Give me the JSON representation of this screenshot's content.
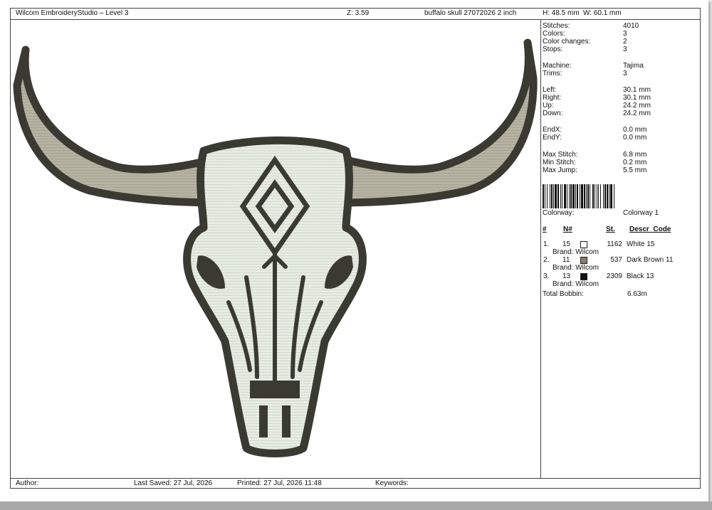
{
  "header": {
    "app_title": "Wilcom EmbroideryStudio – Level 3",
    "zoom": "Z: 3.59",
    "design_name": "buffalo skull 27072026 2 inch",
    "height": "H: 48.5 mm",
    "width": "W: 60.1 mm"
  },
  "stats": [
    {
      "label": "Stitches:",
      "value": "4010"
    },
    {
      "label": "Colors:",
      "value": "3"
    },
    {
      "label": "Color changes:",
      "value": "2"
    },
    {
      "label": "Stops:",
      "value": "3"
    },
    {
      "label": "Machine:",
      "value": "Tajima"
    },
    {
      "label": "Trims:",
      "value": "3"
    },
    {
      "label": "Left:",
      "value": "30.1 mm"
    },
    {
      "label": "Right:",
      "value": "30.1 mm"
    },
    {
      "label": "Up:",
      "value": "24.2 mm"
    },
    {
      "label": "Down:",
      "value": "24.2 mm"
    },
    {
      "label": "EndX:",
      "value": "0.0 mm"
    },
    {
      "label": "EndY:",
      "value": "0.0 mm"
    },
    {
      "label": "Max Stitch:",
      "value": "6.8 mm"
    },
    {
      "label": "Min Stitch:",
      "value": "0.2 mm"
    },
    {
      "label": "Max Jump:",
      "value": "5.5 mm"
    }
  ],
  "colorway": {
    "label": "Colorway:",
    "value": "Colorway 1"
  },
  "table_headers": {
    "num": "#",
    "needle": "N#",
    "stitches": "St.",
    "descr": "Descr_Code"
  },
  "threads": [
    {
      "index": "1.",
      "needle": "15",
      "stitches": "1162",
      "descr": "White 15",
      "brand": "Brand: Wilcom",
      "color": "#ffffff"
    },
    {
      "index": "2.",
      "needle": "11",
      "stitches": "537",
      "descr": "Dark Brown 11",
      "brand": "Brand: Wilcom",
      "color": "#8a7a6a"
    },
    {
      "index": "3.",
      "needle": "13",
      "stitches": "2309",
      "descr": "Black 13",
      "brand": "Brand: Wilcom",
      "color": "#111111"
    }
  ],
  "total_bobbin": {
    "label": "Total Bobbin:",
    "value": "6.63m"
  },
  "footer": {
    "author": "Author:",
    "last_saved": "Last Saved: 27 Jul, 2026",
    "printed": "Printed: 27 Jul, 2026 11:48",
    "keywords": "Keywords:"
  },
  "colors": {
    "fill_white": "#e8ede4",
    "horn_fill": "#b8b4a4",
    "outline": "#3a3a33"
  }
}
